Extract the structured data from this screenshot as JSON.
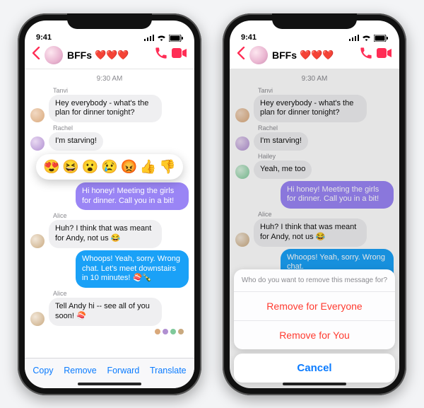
{
  "status": {
    "time": "9:41"
  },
  "header": {
    "title": "BFFs",
    "hearts": "❤️❤️❤️"
  },
  "day": "9:30 AM",
  "senders": {
    "s1": "Tanvi",
    "s2": "Rachel",
    "s3": "Hailey",
    "s4": "Alice"
  },
  "msgs": {
    "m1": "Hey everybody - what's the plan for dinner tonight?",
    "m2": "I'm starving!",
    "m3": "Yeah, me too",
    "m4": "Hi honey! Meeting the girls for dinner. Call you in a bit!",
    "m5": "Huh? I think that was meant for Andy, not us 😂",
    "m6": "Whoops! Yeah, sorry. Wrong chat. Let's meet downstairs in 10 minutes! 🍣🍾",
    "m6b": "Whoops! Yeah, sorry. Wrong chat.",
    "m7": "Tell Andy hi -- see all of you soon! 🍣"
  },
  "reactions": [
    "😍",
    "😆",
    "😮",
    "😢",
    "😡",
    "👍",
    "👎"
  ],
  "menu": {
    "copy": "Copy",
    "remove": "Remove",
    "forward": "Forward",
    "translate": "Translate"
  },
  "sheet": {
    "prompt": "Who do you want to remove this message for?",
    "opt1": "Remove for Everyone",
    "opt2": "Remove for You",
    "cancel": "Cancel"
  }
}
